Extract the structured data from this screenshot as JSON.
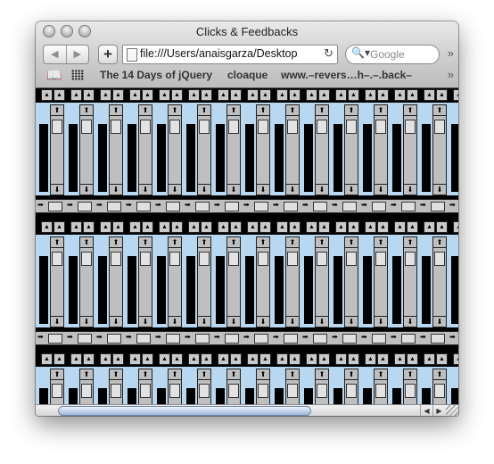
{
  "window": {
    "title": "Clicks & Feedbacks"
  },
  "toolbar": {
    "back_label": "◀",
    "forward_label": "▶",
    "add_label": "+",
    "url": "file:///Users/anaisgarza/Desktop",
    "reload_label": "↻",
    "search_placeholder": "Google",
    "overflow_label": "»"
  },
  "bookmarks": [
    {
      "label": "The 14 Days of jQuery"
    },
    {
      "label": "cloaque"
    },
    {
      "label": "www.–revers…h–.–.back–"
    }
  ],
  "bookmarks_overflow": "»",
  "content": {
    "pattern": "repeating-scrollbar-tiles",
    "colors": {
      "background": "#000000",
      "gutter": "#b7d8f0",
      "control": "#bfbfbf"
    }
  },
  "scrollbar": {
    "left_label": "◀",
    "right_label": "▶"
  }
}
